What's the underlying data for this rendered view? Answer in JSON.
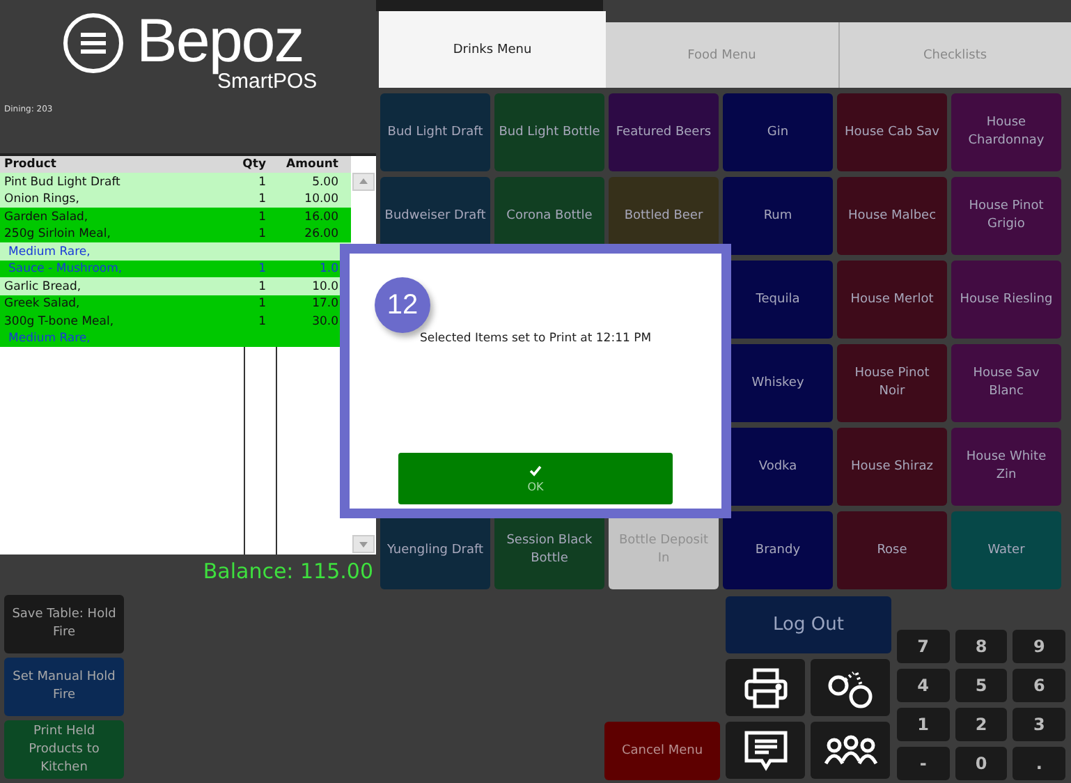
{
  "logo": {
    "name": "Bepoz",
    "subtitle": "SmartPOS"
  },
  "table_label": "Dining: 203",
  "order": {
    "columns": [
      "Product",
      "Qty",
      "Amount"
    ],
    "rows": [
      {
        "kind": "item",
        "selected": false,
        "product": "Pint Bud Light Draft",
        "qty": "1",
        "amount": "5.00"
      },
      {
        "kind": "item",
        "selected": false,
        "product": "Onion Rings,",
        "qty": "1",
        "amount": "10.00"
      },
      {
        "kind": "item",
        "selected": true,
        "product": "Garden Salad,",
        "qty": "1",
        "amount": "16.00"
      },
      {
        "kind": "item",
        "selected": true,
        "product": "250g Sirloin Meal,",
        "qty": "1",
        "amount": "26.00"
      },
      {
        "kind": "modifier",
        "selected": false,
        "product": "Medium Rare,"
      },
      {
        "kind": "modifier",
        "selected": true,
        "product": "Sauce - Mushroom,",
        "qty": "1",
        "amount": "1.0"
      },
      {
        "kind": "item",
        "selected": false,
        "product": "Garlic Bread,",
        "qty": "1",
        "amount": "10.0"
      },
      {
        "kind": "item",
        "selected": true,
        "product": "Greek Salad,",
        "qty": "1",
        "amount": "17.0"
      },
      {
        "kind": "item",
        "selected": true,
        "product": "300g T-bone Meal,",
        "qty": "1",
        "amount": "30.0"
      },
      {
        "kind": "modifier",
        "selected": true,
        "product": "Medium Rare,"
      }
    ]
  },
  "balance": "Balance: 115.00",
  "side_buttons": [
    {
      "label": "Save Table: Hold Fire",
      "color": "#1a1a1a"
    },
    {
      "label": "Set Manual Hold Fire",
      "color": "#0b2a55"
    },
    {
      "label": "Print Held Products to Kitchen",
      "color": "#0c4a25"
    }
  ],
  "tabs": [
    {
      "label": "Drinks Menu",
      "selected": true
    },
    {
      "label": "Food Menu",
      "selected": false
    },
    {
      "label": "Checklists",
      "selected": false
    }
  ],
  "tile_rows": [
    [
      {
        "label": "Bud Light Draft",
        "color": "#0e2a3e"
      },
      {
        "label": "Bud Light Bottle",
        "color": "#113f22"
      },
      {
        "label": "Featured Beers",
        "color": "#2d0a45"
      },
      {
        "label": "Gin",
        "color": "#05064a"
      },
      {
        "label": "House Cab Sav",
        "color": "#3e0b1a"
      },
      {
        "label": "House Chardonnay",
        "color": "#420c42"
      }
    ],
    [
      {
        "label": "Budweiser Draft",
        "color": "#0e2a3e"
      },
      {
        "label": "Corona Bottle",
        "color": "#113f22"
      },
      {
        "label": "Bottled Beer",
        "color": "#36301a"
      },
      {
        "label": "Rum",
        "color": "#05064a"
      },
      {
        "label": "House Malbec",
        "color": "#3e0b1a"
      },
      {
        "label": "House Pinot Grigio",
        "color": "#420c42"
      }
    ],
    [
      {
        "label": "Tequila",
        "color": "#05064a"
      },
      {
        "label": "House Merlot",
        "color": "#3e0b1a"
      },
      {
        "label": "House Riesling",
        "color": "#420c42"
      }
    ],
    [
      {
        "label": "Whiskey",
        "color": "#05064a"
      },
      {
        "label": "House Pinot Noir",
        "color": "#3e0b1a"
      },
      {
        "label": "House Sav Blanc",
        "color": "#420c42"
      }
    ],
    [
      {
        "label": "Vodka",
        "color": "#05064a"
      },
      {
        "label": "House Shiraz",
        "color": "#3e0b1a"
      },
      {
        "label": "House White Zin",
        "color": "#420c42"
      }
    ],
    [
      {
        "label": "Yuengling Draft",
        "color": "#0e2a3e"
      },
      {
        "label": "Session Black Bottle",
        "color": "#113f22"
      },
      {
        "label": "Bottle Deposit In",
        "color": "#c4c4c4"
      },
      {
        "label": "Brandy",
        "color": "#05064a"
      },
      {
        "label": "Rose",
        "color": "#3e0b1a"
      },
      {
        "label": "Water",
        "color": "#064848"
      }
    ]
  ],
  "cancel_button": "Cancel Menu",
  "logout_button": "Log Out",
  "keypad": [
    "7",
    "8",
    "9",
    "4",
    "5",
    "6",
    "1",
    "2",
    "3",
    "-",
    "0",
    "."
  ],
  "dialog": {
    "badge": "12",
    "message": "Selected Items set to Print at 12:11 PM",
    "ok": "OK"
  }
}
